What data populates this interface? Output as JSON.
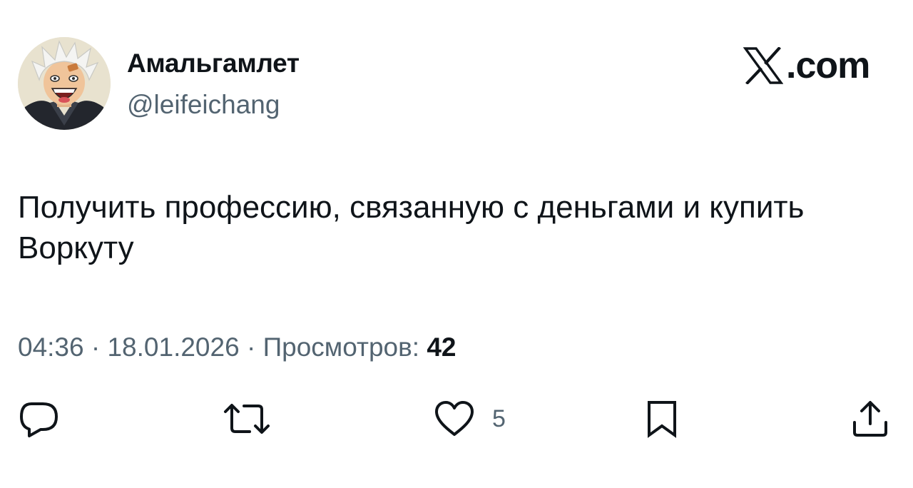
{
  "author": {
    "display_name": "Амальгамлет",
    "handle": "@leifeichang",
    "avatar_icon": "anime-avatar"
  },
  "brand": {
    "logo_icon": "x-logo-icon",
    "domain_suffix": ".com"
  },
  "tweet": {
    "text": "Получить профессию, связанную с деньгами и купить Воркуту"
  },
  "meta": {
    "time": "04:36",
    "separator": " · ",
    "date": "18.01.2026",
    "views_label": "Просмотров:",
    "views_count": "42"
  },
  "actions": {
    "reply_icon": "reply-icon",
    "repost_icon": "repost-icon",
    "like_icon": "heart-icon",
    "like_count": "5",
    "bookmark_icon": "bookmark-icon",
    "share_icon": "share-icon"
  },
  "colors": {
    "text_primary": "#0f1419",
    "text_secondary": "#536471",
    "background": "#ffffff"
  }
}
